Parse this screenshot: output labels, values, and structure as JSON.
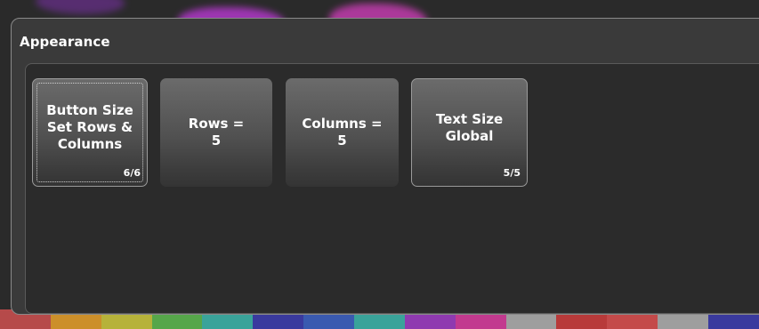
{
  "panel": {
    "title": "Appearance"
  },
  "buttons": [
    {
      "label_lines": [
        "Button Size",
        "Set Rows &",
        "Columns"
      ],
      "count": "6/6",
      "selected": true
    },
    {
      "label_lines": [
        "Rows =",
        "5"
      ],
      "count": ""
    },
    {
      "label_lines": [
        "Columns =",
        "5"
      ],
      "count": ""
    },
    {
      "label_lines": [
        "Text Size",
        "Global"
      ],
      "count": "5/5"
    }
  ],
  "colors": {
    "panel_bg": "#3a3a3a",
    "inner_bg": "#2b2b2b",
    "button_top": "#6b6b6b",
    "button_bottom": "#343434",
    "text": "#ffffff",
    "bottom_strip": [
      "#b64a4a",
      "#cc8f2a",
      "#b6b23a",
      "#56a64a",
      "#3aa39a",
      "#3a3a9e",
      "#3a5ab0",
      "#3aa39a",
      "#8f3ab0",
      "#c23a8f",
      "#9e9e9e",
      "#b83a3a",
      "#c44a4a",
      "#9e9e9e",
      "#3a3a9e"
    ]
  },
  "icons": {
    "count_badge": "index-counter"
  }
}
